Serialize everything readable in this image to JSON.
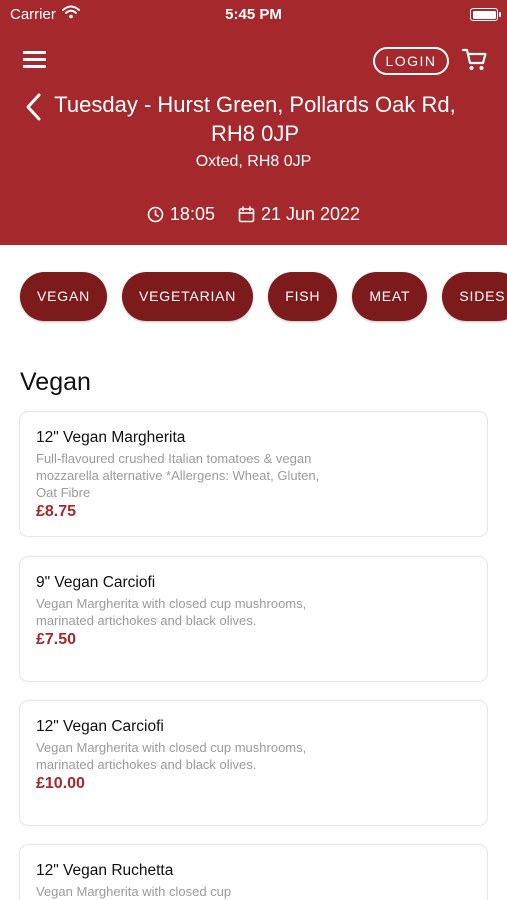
{
  "status_bar": {
    "carrier": "Carrier",
    "time": "5:45 PM"
  },
  "header": {
    "login_label": "LOGIN",
    "title": "Tuesday - Hurst Green, Pollards Oak Rd, RH8 0JP",
    "subtitle": "Oxted, RH8 0JP",
    "time": "18:05",
    "date": "21 Jun 2022"
  },
  "categories": [
    "VEGAN",
    "VEGETARIAN",
    "FISH",
    "MEAT",
    "SIDES"
  ],
  "section": {
    "title": "Vegan"
  },
  "items": [
    {
      "name": "12\" Vegan Margherita",
      "description": "Full-flavoured crushed Italian tomatoes & vegan mozzarella alternative *Allergens: Wheat, Gluten, Oat Fibre",
      "price": "£8.75"
    },
    {
      "name": "9\" Vegan Carciofi",
      "description": "Vegan Margherita with closed cup mushrooms, marinated artichokes and black olives.",
      "price": "£7.50"
    },
    {
      "name": "12\" Vegan Carciofi",
      "description": "Vegan Margherita with closed cup mushrooms, marinated artichokes and black olives.",
      "price": "£10.00"
    },
    {
      "name": "12\" Vegan Ruchetta",
      "description": "Vegan Margherita with closed cup",
      "price": ""
    }
  ],
  "colors": {
    "header_bg": "#a4282c",
    "chip_bg": "#7c1a1c",
    "price": "#a4282c"
  },
  "icons": [
    "wifi-icon",
    "battery-icon",
    "menu-icon",
    "cart-icon",
    "back-chevron-icon",
    "clock-icon",
    "calendar-icon"
  ]
}
